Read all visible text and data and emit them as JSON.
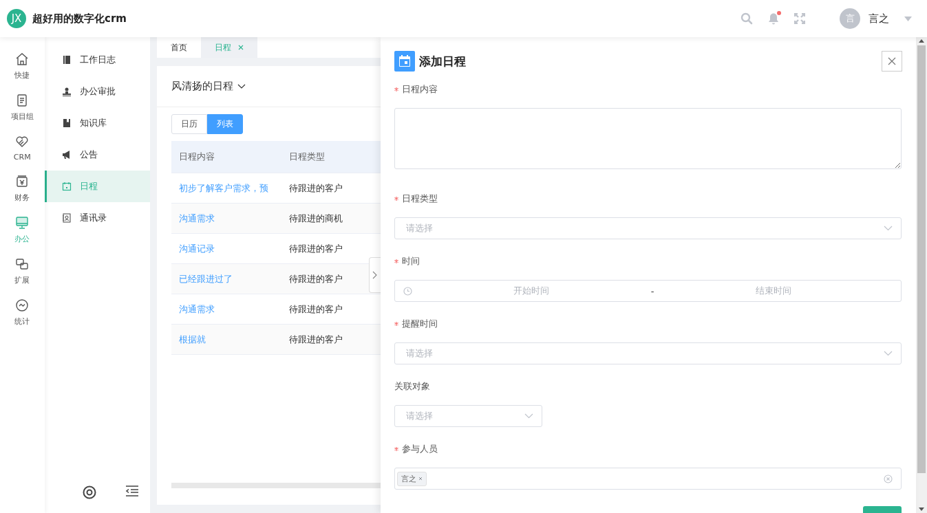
{
  "header": {
    "logo_text": "JX",
    "title": "超好用的数字化crm",
    "notification_dot": true,
    "user": {
      "avatar_text": "言",
      "name": "言之"
    }
  },
  "rail": [
    {
      "label": "快捷",
      "selected": false
    },
    {
      "label": "项目组",
      "selected": false
    },
    {
      "label": "CRM",
      "selected": false
    },
    {
      "label": "财务",
      "selected": false
    },
    {
      "label": "办公",
      "selected": true
    },
    {
      "label": "扩展",
      "selected": false
    },
    {
      "label": "统计",
      "selected": false
    }
  ],
  "sidebar": {
    "items": [
      {
        "label": "工作日志",
        "selected": false
      },
      {
        "label": "办公审批",
        "selected": false
      },
      {
        "label": "知识库",
        "selected": false
      },
      {
        "label": "公告",
        "selected": false
      },
      {
        "label": "日程",
        "selected": true
      },
      {
        "label": "通讯录",
        "selected": false
      }
    ]
  },
  "tabs": [
    {
      "label": "首页",
      "selected": false,
      "closable": false
    },
    {
      "label": "日程",
      "selected": true,
      "closable": true
    }
  ],
  "schedule": {
    "owner": "风清扬的日程",
    "views": [
      {
        "label": "日历",
        "selected": false
      },
      {
        "label": "列表",
        "selected": true
      }
    ],
    "table": {
      "columns": [
        "日程内容",
        "日程类型"
      ],
      "rows": [
        {
          "content": "初步了解客户需求，预",
          "type": "待跟进的客户"
        },
        {
          "content": "沟通需求",
          "type": "待跟进的商机"
        },
        {
          "content": "沟通记录",
          "type": "待跟进的客户"
        },
        {
          "content": "已经跟进过了",
          "type": "待跟进的客户"
        },
        {
          "content": "沟通需求",
          "type": "待跟进的客户"
        },
        {
          "content": "根据就",
          "type": "待跟进的客户"
        }
      ]
    }
  },
  "drawer": {
    "title": "添加日程",
    "fields": [
      {
        "kind": "textarea",
        "label": "日程内容",
        "required": true
      },
      {
        "kind": "select",
        "label": "日程类型",
        "required": true,
        "placeholder": "请选择"
      },
      {
        "kind": "daterange",
        "label": "时间",
        "required": true,
        "start_placeholder": "开始时间",
        "separator": "-",
        "end_placeholder": "结束时间"
      },
      {
        "kind": "select",
        "label": "提醒时间",
        "required": true,
        "placeholder": "请选择"
      },
      {
        "kind": "select_short",
        "label": "关联对象",
        "required": false,
        "placeholder": "请选择"
      },
      {
        "kind": "tags",
        "label": "参与人员",
        "required": true,
        "tags": [
          "言之"
        ]
      }
    ]
  }
}
